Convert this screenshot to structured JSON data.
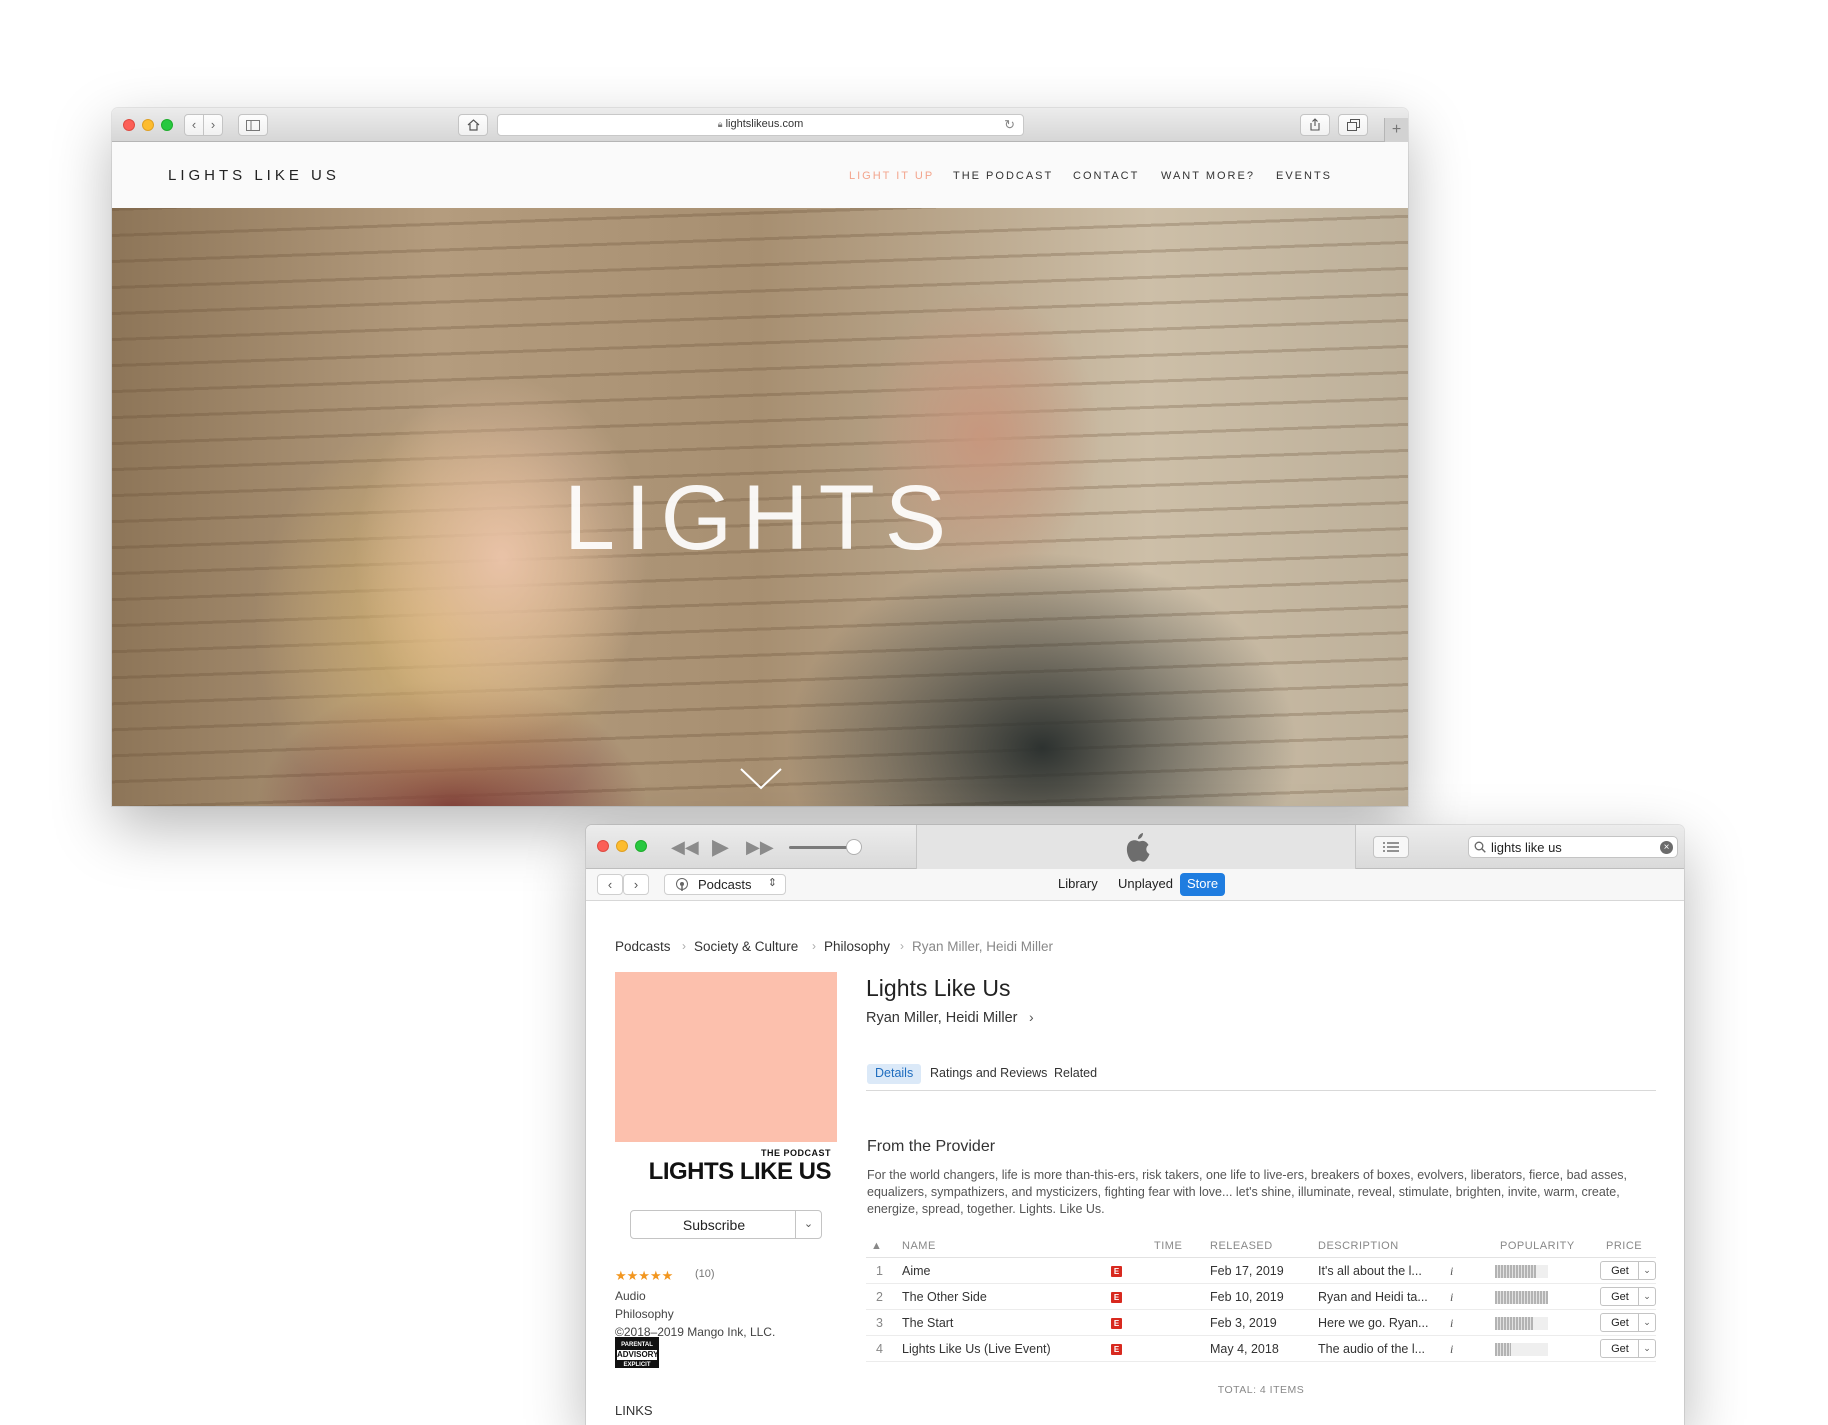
{
  "safari": {
    "url": "lightslikeus.com",
    "site_logo": "LIGHTS LIKE US",
    "nav": [
      "LIGHT IT UP",
      "THE PODCAST",
      "CONTACT",
      "WANT MORE?",
      "EVENTS"
    ],
    "active_nav": "LIGHT IT UP",
    "hero_title": "LIGHTS",
    "colors": {
      "nav_active": "#f3a58d"
    },
    "icons": [
      "back-icon",
      "forward-icon",
      "sidebar-icon",
      "home-icon",
      "lock-icon",
      "reload-icon",
      "share-icon",
      "tabs-icon",
      "new-tab-icon",
      "chevron-down-icon"
    ]
  },
  "itunes": {
    "search_query": "lights like us",
    "media_kind": "Podcasts",
    "tabs": [
      "Library",
      "Unplayed",
      "Store"
    ],
    "active_tab": "Store",
    "breadcrumbs": [
      "Podcasts",
      "Society & Culture",
      "Philosophy",
      "Ryan Miller, Heidi Miller"
    ],
    "artwork": {
      "subtitle": "THE PODCAST",
      "title": "LIGHTS LIKE US",
      "background": "#fcc0ad"
    },
    "subscribe_label": "Subscribe",
    "stars": "★★★★★",
    "rating_count": "(10)",
    "meta": [
      "Audio",
      "Philosophy",
      "©2018–2019 Mango Ink, LLC."
    ],
    "advisory": {
      "top": "PARENTAL",
      "mid": "ADVISORY",
      "bottom": "EXPLICIT CONTENT"
    },
    "links_heading": "LINKS",
    "podcast_title": "Lights Like Us",
    "podcast_author": "Ryan Miller, Heidi Miller",
    "detail_tabs": [
      "Details",
      "Ratings and Reviews",
      "Related"
    ],
    "active_detail_tab": "Details",
    "provider_heading": "From the Provider",
    "provider_description": "For the world changers, life is more than-this-ers, risk takers, one life to live-ers, breakers of boxes, evolvers, liberators, fierce, bad asses, equalizers, sympathizers, and mysticizers, fighting fear with love... let's shine, illuminate, reveal, stimulate, brighten, invite, warm, create, energize, spread, together. Lights. Like Us.",
    "table": {
      "sort_indicator": "▲",
      "columns": [
        "NAME",
        "TIME",
        "RELEASED",
        "DESCRIPTION",
        "POPULARITY",
        "PRICE"
      ],
      "explicit_badge": "E",
      "info_glyph": "i",
      "get_label": "Get",
      "rows": [
        {
          "num": "1",
          "name": "Aime",
          "released": "Feb 17, 2019",
          "description": "It's all about the l...",
          "popularity": 0.78
        },
        {
          "num": "2",
          "name": "The Other Side",
          "released": "Feb 10, 2019",
          "description": "Ryan and Heidi ta...",
          "popularity": 1.0
        },
        {
          "num": "3",
          "name": "The Start",
          "released": "Feb 3, 2019",
          "description": "Here we go. Ryan...",
          "popularity": 0.72
        },
        {
          "num": "4",
          "name": "Lights Like Us (Live Event)",
          "released": "May 4, 2018",
          "description": "The audio of the l...",
          "popularity": 0.3
        }
      ],
      "total": "TOTAL: 4 ITEMS"
    },
    "colors": {
      "store_tab": "#1f7de0",
      "explicit": "#d8291f",
      "stars": "#f2961f"
    },
    "icons": [
      "rewind-icon",
      "play-icon",
      "fast-forward-icon",
      "apple-logo-icon",
      "list-icon",
      "search-icon",
      "clear-icon",
      "podcast-icon"
    ]
  }
}
